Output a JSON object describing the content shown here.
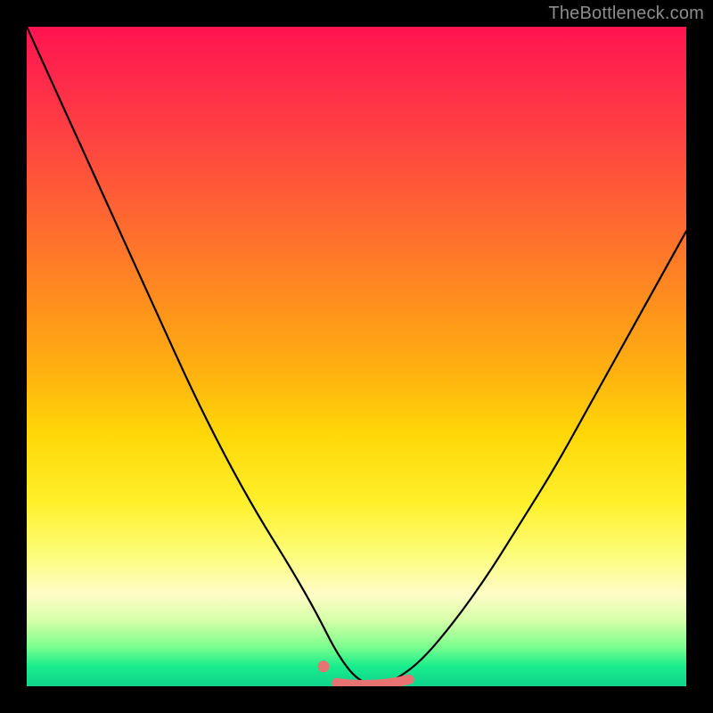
{
  "watermark": "TheBottleneck.com",
  "colors": {
    "frame": "#000000",
    "curve": "#000000",
    "marker": "#e97272",
    "marker_outline": "#e97272"
  },
  "chart_data": {
    "type": "line",
    "title": "",
    "xlabel": "",
    "ylabel": "",
    "xlim": [
      0,
      100
    ],
    "ylim": [
      0,
      100
    ],
    "grid": false,
    "series": [
      {
        "name": "v-curve",
        "x": [
          0,
          5,
          10,
          15,
          20,
          25,
          30,
          35,
          40,
          44,
          47,
          50,
          53,
          56,
          60,
          65,
          70,
          75,
          80,
          85,
          90,
          95,
          100
        ],
        "values": [
          100,
          89,
          78,
          67,
          56,
          45,
          35,
          26,
          18,
          11,
          5,
          1,
          0,
          1,
          4,
          10,
          17,
          25,
          33,
          42,
          51,
          60,
          69
        ]
      }
    ],
    "markers": [
      {
        "name": "flat-minimum-band",
        "x_start": 47,
        "x_end": 58,
        "y": 0.5
      },
      {
        "name": "secondary-point",
        "x": 45,
        "y": 3
      }
    ],
    "gradient_stops": [
      {
        "pos": 0.0,
        "color": "#ff1450"
      },
      {
        "pos": 0.3,
        "color": "#ff6a30"
      },
      {
        "pos": 0.62,
        "color": "#ffd808"
      },
      {
        "pos": 0.86,
        "color": "#fffcc6"
      },
      {
        "pos": 0.97,
        "color": "#18ec8c"
      },
      {
        "pos": 1.0,
        "color": "#0fd48c"
      }
    ]
  }
}
